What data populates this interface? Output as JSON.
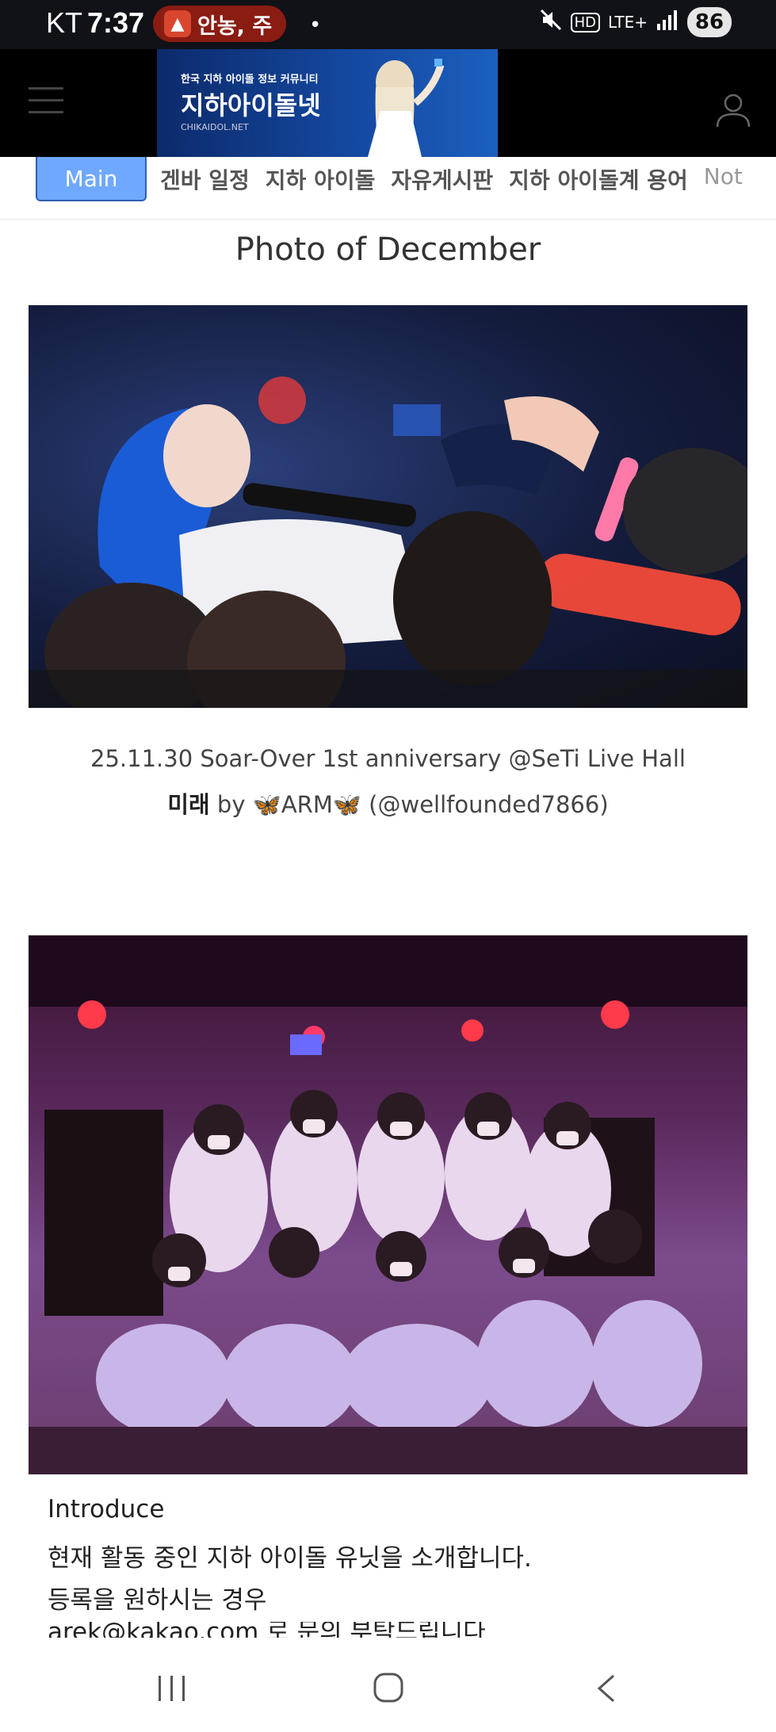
{
  "status_bar": {
    "carrier": "KT",
    "time": "7:37",
    "notification_text": "안농, 주",
    "notification_icon": "app-icon",
    "dot": "•",
    "hd": "HD",
    "network": "LTE+",
    "battery": "86"
  },
  "header": {
    "banner_small": "한국 지하 아이돌 정보 커뮤니티",
    "banner_title": "지하아이돌넷",
    "banner_url": "CHIKAIDOL.NET"
  },
  "nav": {
    "main_label": "Main",
    "items": [
      "겐바 일정",
      "지하 아이돌",
      "자유게시판",
      "지하 아이돌계 용어",
      "Not"
    ]
  },
  "main": {
    "section_title": "Photo of December",
    "photo1_caption_line1": "25.11.30 Soar-Over 1st anniversary @SeTi Live Hall",
    "photo1_caption_name": "미래",
    "photo1_caption_rest": " by 🦋ARM🦋 (@wellfounded7866)",
    "intro_title": "Introduce",
    "intro_line1": "현재 활동 중인 지하 아이돌 유닛을 소개합니다.",
    "intro_line2": "등록을 원하시는 경우",
    "intro_line3": "arek@kakao.com 로 문의 부탁드립니다"
  },
  "colors": {
    "nav_active_bg": "#6ea8ff",
    "header_bg": "#000000",
    "status_bg": "#111217"
  }
}
